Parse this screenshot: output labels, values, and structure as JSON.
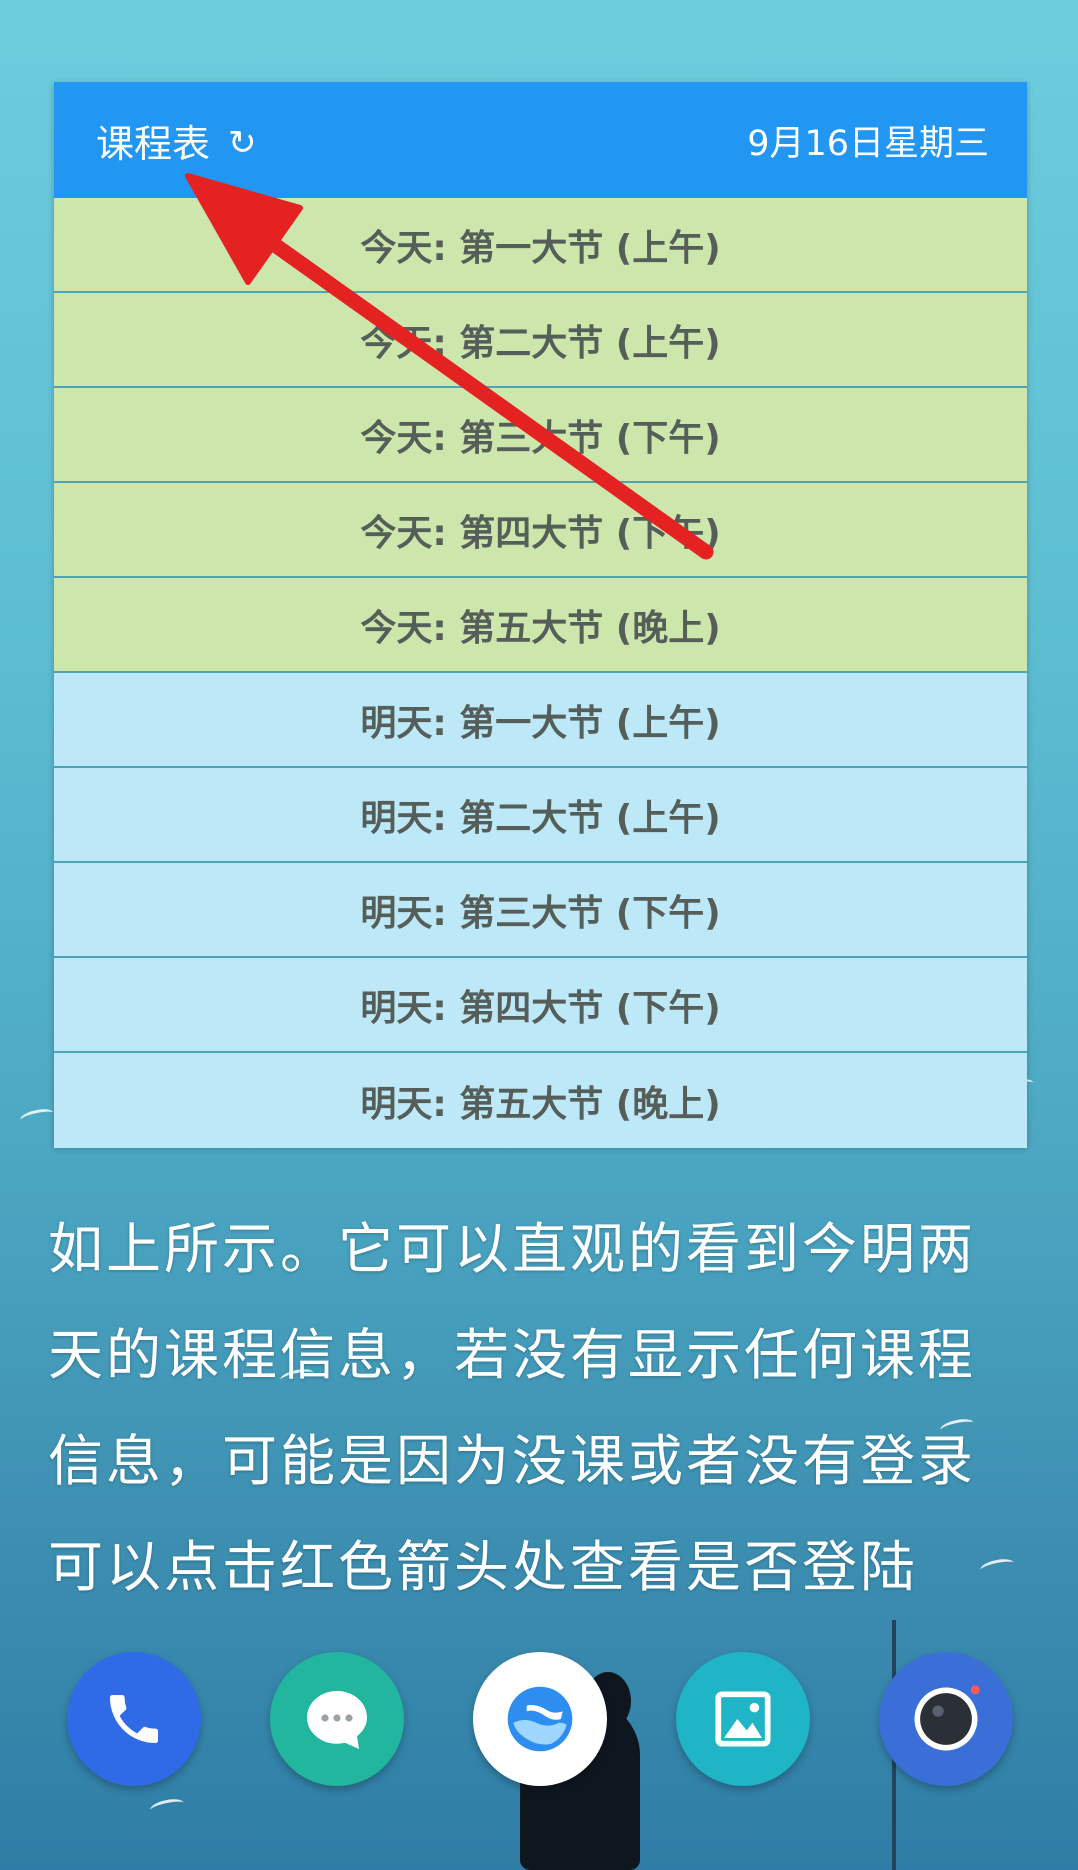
{
  "widget": {
    "title": "课程表",
    "refresh_icon": "↻",
    "date": "9月16日星期三",
    "today_rows": [
      "今天: 第一大节 (上午)",
      "今天: 第二大节 (上午)",
      "今天: 第三大节 (下午)",
      "今天: 第四大节 (下午)",
      "今天: 第五大节 (晚上)"
    ],
    "tomorrow_rows": [
      "明天: 第一大节 (上午)",
      "明天: 第二大节 (上午)",
      "明天: 第三大节 (下午)",
      "明天: 第四大节 (下午)",
      "明天: 第五大节 (晚上)"
    ]
  },
  "caption": {
    "lines": [
      "如上所示。它可以直观的看到今明两",
      "天的课程信息，若没有显示任何课程",
      "信息，可能是因为没课或者没有登录",
      "可以点击红色箭头处查看是否登陆"
    ]
  },
  "dock": {
    "apps": [
      "phone-icon",
      "messages-icon",
      "browser-icon",
      "gallery-icon",
      "camera-icon"
    ]
  },
  "colors": {
    "header": "#2196f3",
    "today_row": "#cde6ac",
    "tomorrow_row": "#bde8f8",
    "arrow": "#e52222"
  }
}
